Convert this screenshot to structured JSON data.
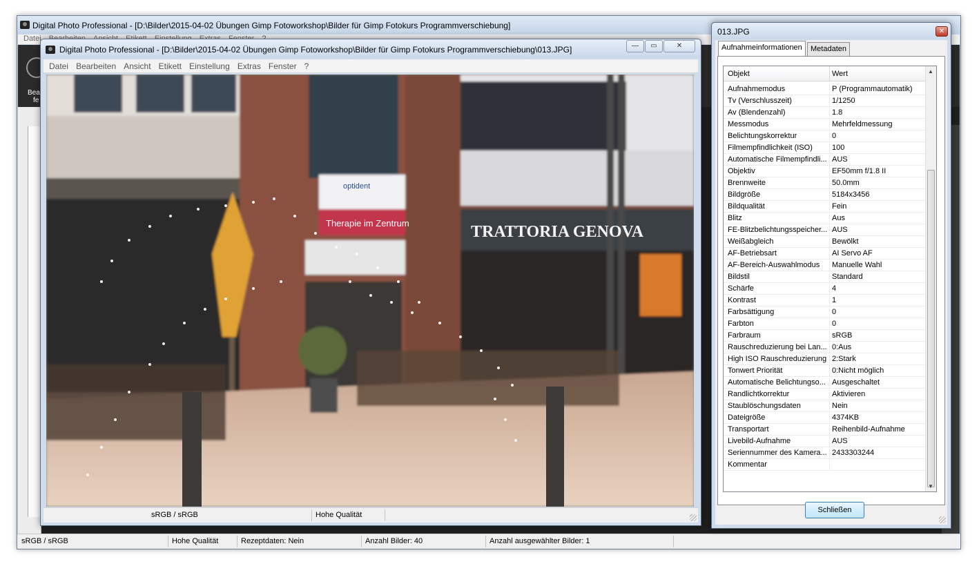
{
  "main_window": {
    "title": "Digital Photo Professional - [D:\\Bilder\\2015-04-02 Übungen  Gimp Fotoworkshop\\Bilder für Gimp Fotokurs Programmverschiebung]",
    "menu": [
      "Datei",
      "Bearbeiten",
      "Ansicht",
      "Etikett",
      "Einstellung",
      "Extras",
      "Fenster",
      "?"
    ],
    "toolbar_label_1": "Bea",
    "toolbar_label_2": "fe",
    "status": {
      "color_space": "sRGB / sRGB",
      "quality": "Hohe Qualität",
      "recipe": "Rezeptdaten: Nein",
      "count": "Anzahl Bilder: 40",
      "selected": "Anzahl ausgewählter Bilder: 1"
    }
  },
  "viewer_window": {
    "title": "Digital Photo Professional - [D:\\Bilder\\2015-04-02 Übungen  Gimp Fotoworkshop\\Bilder für Gimp Fotokurs Programmverschiebung\\013.JPG]",
    "menu": [
      "Datei",
      "Bearbeiten",
      "Ansicht",
      "Etikett",
      "Einstellung",
      "Extras",
      "Fenster",
      "?"
    ],
    "photo_signs": {
      "optident": "optident",
      "therapie": "Therapie im Zentrum",
      "trattoria": "TRATTORIA GENOVA"
    },
    "status": {
      "color_space": "sRGB / sRGB",
      "quality": "Hohe Qualität"
    }
  },
  "info_dialog": {
    "title": "013.JPG",
    "close_icon": "✕",
    "tabs": [
      "Aufnahmeinformationen",
      "Metadaten"
    ],
    "columns": {
      "key": "Objekt",
      "value": "Wert"
    },
    "rows": [
      {
        "k": "Aufnahmemodus",
        "v": "P (Programmautomatik)"
      },
      {
        "k": "Tv (Verschlusszeit)",
        "v": "1/1250"
      },
      {
        "k": "Av (Blendenzahl)",
        "v": "1.8"
      },
      {
        "k": "Messmodus",
        "v": "Mehrfeldmessung"
      },
      {
        "k": "Belichtungskorrektur",
        "v": "0"
      },
      {
        "k": "Filmempfindlichkeit (ISO)",
        "v": "100"
      },
      {
        "k": "Automatische Filmempfindli...",
        "v": "AUS"
      },
      {
        "k": "Objektiv",
        "v": "EF50mm f/1.8 II"
      },
      {
        "k": "Brennweite",
        "v": "50.0mm"
      },
      {
        "k": "Bildgröße",
        "v": "5184x3456"
      },
      {
        "k": "Bildqualität",
        "v": "Fein"
      },
      {
        "k": "Blitz",
        "v": "Aus"
      },
      {
        "k": "FE-Blitzbelichtungsspeicher...",
        "v": "AUS"
      },
      {
        "k": "Weißabgleich",
        "v": "Bewölkt"
      },
      {
        "k": "AF-Betriebsart",
        "v": "AI Servo AF"
      },
      {
        "k": "AF-Bereich-Auswahlmodus",
        "v": "Manuelle  Wahl"
      },
      {
        "k": "Bildstil",
        "v": "Standard"
      },
      {
        "k": "Schärfe",
        "v": "4"
      },
      {
        "k": "Kontrast",
        "v": "1"
      },
      {
        "k": "Farbsättigung",
        "v": "0"
      },
      {
        "k": "Farbton",
        "v": "0"
      },
      {
        "k": "Farbraum",
        "v": "sRGB"
      },
      {
        "k": "Rauschreduzierung bei Lan...",
        "v": "0:Aus"
      },
      {
        "k": "High ISO Rauschreduzierung",
        "v": "2:Stark"
      },
      {
        "k": "Tonwert Priorität",
        "v": "0:Nicht möglich"
      },
      {
        "k": "Automatische Belichtungso...",
        "v": "Ausgeschaltet"
      },
      {
        "k": "Randlichtkorrektur",
        "v": "Aktivieren"
      },
      {
        "k": "Staublöschungsdaten",
        "v": "Nein"
      },
      {
        "k": "Dateigröße",
        "v": "4374KB"
      },
      {
        "k": "Transportart",
        "v": "Reihenbild-Aufnahme"
      },
      {
        "k": "Livebild-Aufnahme",
        "v": "AUS"
      },
      {
        "k": "Seriennummer des Kamera...",
        "v": "2433303244"
      },
      {
        "k": "Kommentar",
        "v": ""
      }
    ],
    "close_button": "Schließen"
  }
}
